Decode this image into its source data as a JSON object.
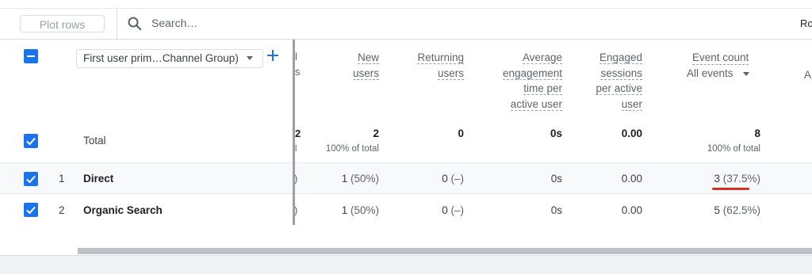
{
  "toolbar": {
    "plot_rows_label": "Plot rows",
    "search_placeholder": "Search...",
    "search_text": "Search…",
    "rows_label_partial": "Ro"
  },
  "dimension": {
    "selector_label": "First user prim…Channel Group)",
    "add_icon": "plus-icon",
    "dropdown_icon": "caret-down-icon"
  },
  "partial_column": {
    "header_chars": [
      "l",
      "s"
    ],
    "total_value": "2",
    "total_sub": "l",
    "row_chars": [
      ")",
      ")"
    ]
  },
  "columns": [
    {
      "key": "new_users",
      "lines": [
        "New",
        "users"
      ]
    },
    {
      "key": "returning_users",
      "lines": [
        "Returning",
        "users"
      ]
    },
    {
      "key": "avg_engagement",
      "lines": [
        "Average",
        "engagement",
        "time per",
        "active user"
      ]
    },
    {
      "key": "engaged_sessions",
      "lines": [
        "Engaged",
        "sessions",
        "per active",
        "user"
      ]
    },
    {
      "key": "event_count",
      "lines": [
        "Event count"
      ],
      "sub": "All events"
    }
  ],
  "right_partial_header": "A",
  "totals": {
    "label": "Total",
    "new_users": "2",
    "new_users_sub": "100% of total",
    "returning_users": "0",
    "avg_engagement": "0s",
    "engaged_sessions": "0.00",
    "event_count": "8",
    "event_count_sub": "100% of total"
  },
  "rows": [
    {
      "index": "1",
      "channel": "Direct",
      "new_users": "1",
      "new_users_pct": "(50%)",
      "returning_users": "0",
      "returning_users_pct": "(–)",
      "avg_engagement": "0s",
      "engaged_sessions": "0.00",
      "event_count": "3",
      "event_count_pct": "(37.5%)"
    },
    {
      "index": "2",
      "channel": "Organic Search",
      "new_users": "1",
      "new_users_pct": "(50%)",
      "returning_users": "0",
      "returning_users_pct": "(–)",
      "avg_engagement": "0s",
      "engaged_sessions": "0.00",
      "event_count": "5",
      "event_count_pct": "(62.5%)"
    }
  ],
  "colors": {
    "accent": "#1a73e8",
    "annotation": "#d93025"
  }
}
